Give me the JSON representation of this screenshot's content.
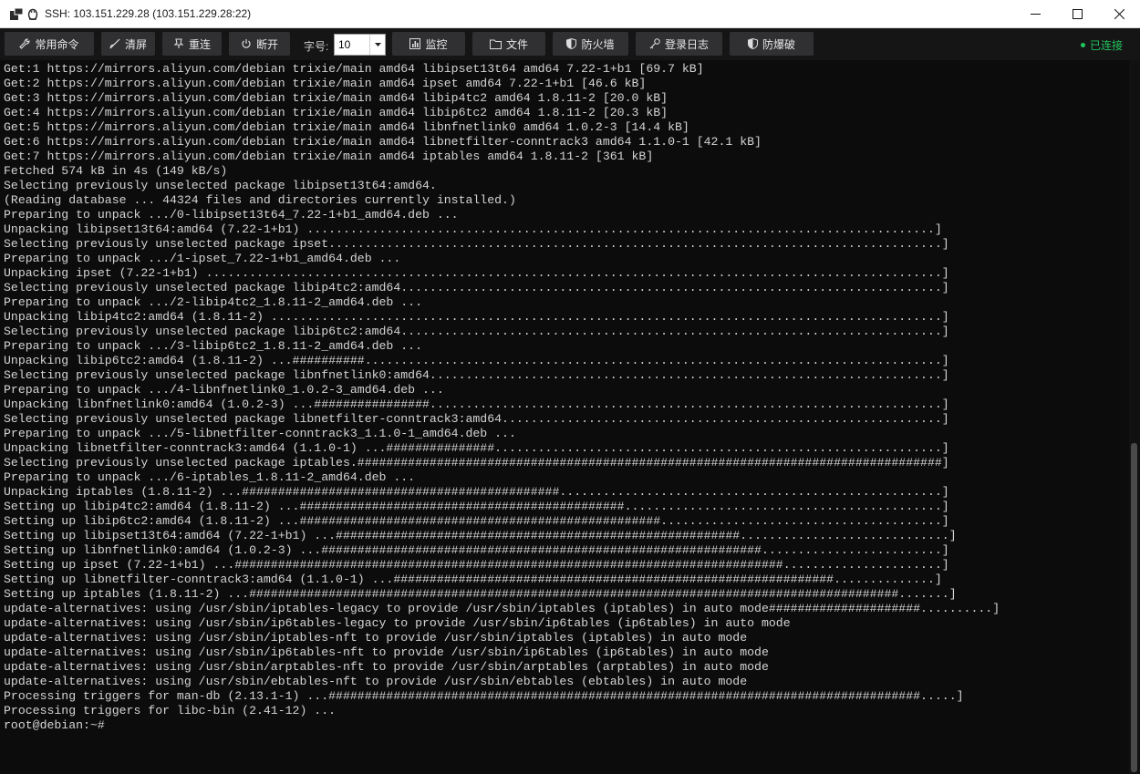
{
  "window": {
    "title": "SSH: 103.151.229.28 (103.151.229.28:22)"
  },
  "toolbar": {
    "buttons": [
      {
        "icon": "wrench-icon",
        "label": "常用命令"
      },
      {
        "icon": "brush-icon",
        "label": "清屏"
      },
      {
        "icon": "pin-icon",
        "label": "重连"
      },
      {
        "icon": "power-icon",
        "label": "断开"
      },
      {
        "icon": "chart-icon",
        "label": "监控"
      },
      {
        "icon": "folder-icon",
        "label": "文件"
      },
      {
        "icon": "shield-icon",
        "label": "防火墙"
      },
      {
        "icon": "key-icon",
        "label": "登录日志"
      },
      {
        "icon": "shield-icon",
        "label": "防爆破"
      }
    ],
    "font_size_label": "字号:",
    "font_size_value": "10",
    "status_label": "已连接",
    "status_color": "#22c55e"
  },
  "terminal": {
    "lines": [
      "Get:1 https://mirrors.aliyun.com/debian trixie/main amd64 libipset13t64 amd64 7.22-1+b1 [69.7 kB]",
      "Get:2 https://mirrors.aliyun.com/debian trixie/main amd64 ipset amd64 7.22-1+b1 [46.6 kB]",
      "Get:3 https://mirrors.aliyun.com/debian trixie/main amd64 libip4tc2 amd64 1.8.11-2 [20.0 kB]",
      "Get:4 https://mirrors.aliyun.com/debian trixie/main amd64 libip6tc2 amd64 1.8.11-2 [20.3 kB]",
      "Get:5 https://mirrors.aliyun.com/debian trixie/main amd64 libnfnetlink0 amd64 1.0.2-3 [14.4 kB]",
      "Get:6 https://mirrors.aliyun.com/debian trixie/main amd64 libnetfilter-conntrack3 amd64 1.1.0-1 [42.1 kB]",
      "Get:7 https://mirrors.aliyun.com/debian trixie/main amd64 iptables amd64 1.8.11-2 [361 kB]",
      "Fetched 574 kB in 4s (149 kB/s)",
      "Selecting previously unselected package libipset13t64:amd64.",
      "(Reading database ... 44324 files and directories currently installed.)",
      "Preparing to unpack .../0-libipset13t64_7.22-1+b1_amd64.deb ...",
      "Unpacking libipset13t64:amd64 (7.22-1+b1) .......................................................................................]",
      "Selecting previously unselected package ipset.....................................................................................]",
      "Preparing to unpack .../1-ipset_7.22-1+b1_amd64.deb ...",
      "Unpacking ipset (7.22-1+b1) ......................................................................................................]",
      "Selecting previously unselected package libip4tc2:amd64...........................................................................]",
      "Preparing to unpack .../2-libip4tc2_1.8.11-2_amd64.deb ...",
      "Unpacking libip4tc2:amd64 (1.8.11-2) .............................................................................................]",
      "Selecting previously unselected package libip6tc2:amd64...........................................................................]",
      "Preparing to unpack .../3-libip6tc2_1.8.11-2_amd64.deb ...",
      "Unpacking libip6tc2:amd64 (1.8.11-2) ...##########................................................................................]",
      "Selecting previously unselected package libnfnetlink0:amd64.......................................................................]",
      "Preparing to unpack .../4-libnfnetlink0_1.0.2-3_amd64.deb ...",
      "Unpacking libnfnetlink0:amd64 (1.0.2-3) ...################.......................................................................]",
      "Selecting previously unselected package libnetfilter-conntrack3:amd64.............................................................]",
      "Preparing to unpack .../5-libnetfilter-conntrack3_1.1.0-1_amd64.deb ...",
      "Unpacking libnetfilter-conntrack3:amd64 (1.1.0-1) ...###############..............................................................]",
      "Selecting previously unselected package iptables.#################################################################################]",
      "Preparing to unpack .../6-iptables_1.8.11-2_amd64.deb ...",
      "Unpacking iptables (1.8.11-2) ...############################################.....................................................]",
      "Setting up libip4tc2:amd64 (1.8.11-2) ...#############################################............................................]",
      "Setting up libip6tc2:amd64 (1.8.11-2) ...##################################################.......................................]",
      "Setting up libipset13t64:amd64 (7.22-1+b1) ...########################################################.............................]",
      "Setting up libnfnetlink0:amd64 (1.0.2-3) ...#############################################################.........................]",
      "Setting up ipset (7.22-1+b1) ...############################################################################......................]",
      "Setting up libnetfilter-conntrack3:amd64 (1.1.0-1) ...#############################################################..............]",
      "Setting up iptables (1.8.11-2) ...##########################################################################################.......]",
      "update-alternatives: using /usr/sbin/iptables-legacy to provide /usr/sbin/iptables (iptables) in auto mode#####################..........]",
      "update-alternatives: using /usr/sbin/ip6tables-legacy to provide /usr/sbin/ip6tables (ip6tables) in auto mode",
      "update-alternatives: using /usr/sbin/iptables-nft to provide /usr/sbin/iptables (iptables) in auto mode",
      "update-alternatives: using /usr/sbin/ip6tables-nft to provide /usr/sbin/ip6tables (ip6tables) in auto mode",
      "update-alternatives: using /usr/sbin/arptables-nft to provide /usr/sbin/arptables (arptables) in auto mode",
      "update-alternatives: using /usr/sbin/ebtables-nft to provide /usr/sbin/ebtables (ebtables) in auto mode",
      "Processing triggers for man-db (2.13.1-1) ...##################################################################################.....]",
      "Processing triggers for libc-bin (2.41-12) ...",
      "root@debian:~#"
    ]
  }
}
